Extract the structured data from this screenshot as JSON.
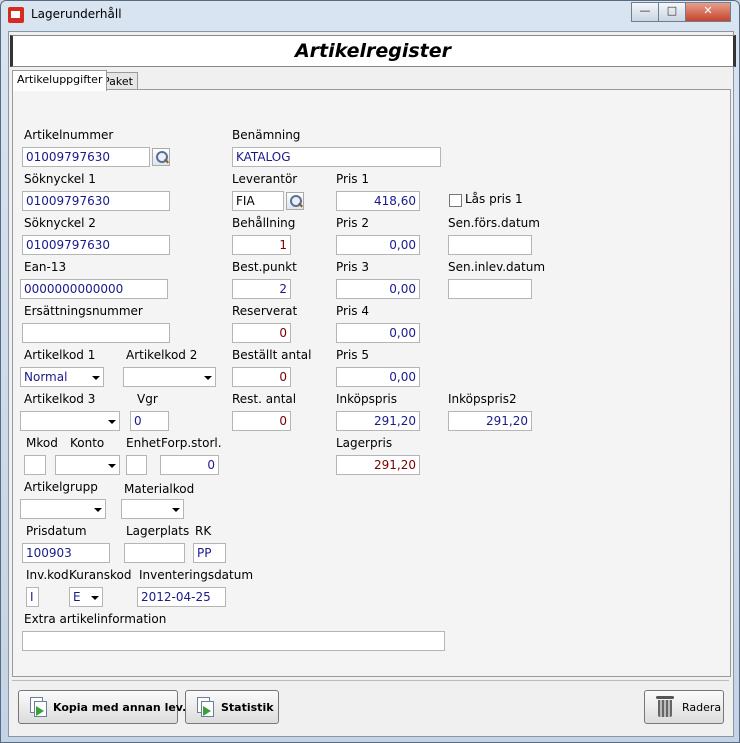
{
  "window": {
    "title": "Lagerunderhåll"
  },
  "header": {
    "title": "Artikelregister"
  },
  "tabs": [
    {
      "label": "Artikeluppgifter"
    },
    {
      "label": "Paket"
    }
  ],
  "form": {
    "artikelnummer": {
      "label": "Artikelnummer",
      "value": "01009797630"
    },
    "benamning": {
      "label": "Benämning",
      "value": "KATALOG"
    },
    "soknyckel1": {
      "label": "Söknyckel 1",
      "value": "01009797630"
    },
    "leverantor": {
      "label": "Leverantör",
      "value": "FIA"
    },
    "pris1": {
      "label": "Pris 1",
      "value": "418,60"
    },
    "las_pris1": {
      "label": "Lås pris 1"
    },
    "soknyckel2": {
      "label": "Söknyckel 2",
      "value": "01009797630"
    },
    "behallning": {
      "label": "Behållning",
      "value": "1"
    },
    "pris2": {
      "label": "Pris 2",
      "value": "0,00"
    },
    "sen_fors_datum": {
      "label": "Sen.förs.datum",
      "value": ""
    },
    "ean13": {
      "label": "Ean-13",
      "value": "0000000000000"
    },
    "best_punkt": {
      "label": "Best.punkt",
      "value": "2"
    },
    "pris3": {
      "label": "Pris 3",
      "value": "0,00"
    },
    "sen_inlev_datum": {
      "label": "Sen.inlev.datum",
      "value": ""
    },
    "ersattningsnummer": {
      "label": "Ersättningsnummer",
      "value": ""
    },
    "reserverat": {
      "label": "Reserverat",
      "value": "0"
    },
    "pris4": {
      "label": "Pris 4",
      "value": "0,00"
    },
    "artikelkod1": {
      "label": "Artikelkod 1",
      "value": "Normal"
    },
    "artikelkod2": {
      "label": "Artikelkod 2",
      "value": ""
    },
    "bestallt_antal": {
      "label": "Beställt antal",
      "value": "0"
    },
    "pris5": {
      "label": "Pris 5",
      "value": "0,00"
    },
    "artikelkod3": {
      "label": "Artikelkod 3",
      "value": ""
    },
    "vgr": {
      "label": "Vgr",
      "value": "0"
    },
    "rest_antal": {
      "label": "Rest. antal",
      "value": "0"
    },
    "inkopspris": {
      "label": "Inköpspris",
      "value": "291,20"
    },
    "inkopspris2": {
      "label": "Inköpspris2",
      "value": "291,20"
    },
    "mkod": {
      "label": "Mkod",
      "value": ""
    },
    "konto": {
      "label": "Konto",
      "value": ""
    },
    "enhet": {
      "label": "Enhet",
      "value": ""
    },
    "forp_storl": {
      "label": "Forp.storl.",
      "value": "0"
    },
    "lagerpris": {
      "label": "Lagerpris",
      "value": "291,20"
    },
    "artikelgrupp": {
      "label": "Artikelgrupp",
      "value": ""
    },
    "materialkod": {
      "label": "Materialkod",
      "value": ""
    },
    "prisdatum": {
      "label": "Prisdatum",
      "value": "100903"
    },
    "lagerplats": {
      "label": "Lagerplats",
      "value": ""
    },
    "rk": {
      "label": "RK",
      "value": "PP"
    },
    "inv_kod": {
      "label": "Inv.kod.",
      "value": "I"
    },
    "kuranskod": {
      "label": "Kuranskod",
      "value": "E"
    },
    "inventeringsdatum": {
      "label": "Inventeringsdatum",
      "value": "2012-04-25"
    },
    "extra_info": {
      "label": "Extra artikelinformation",
      "value": ""
    }
  },
  "buttons": {
    "kopia": "Kopia med annan lev.",
    "statistik": "Statistik",
    "radera": "Radera"
  },
  "icons": [
    "app-icon",
    "minimize-icon",
    "maximize-icon",
    "close-icon",
    "search-icon",
    "copy-icon",
    "trash-icon",
    "chevron-down-icon"
  ]
}
